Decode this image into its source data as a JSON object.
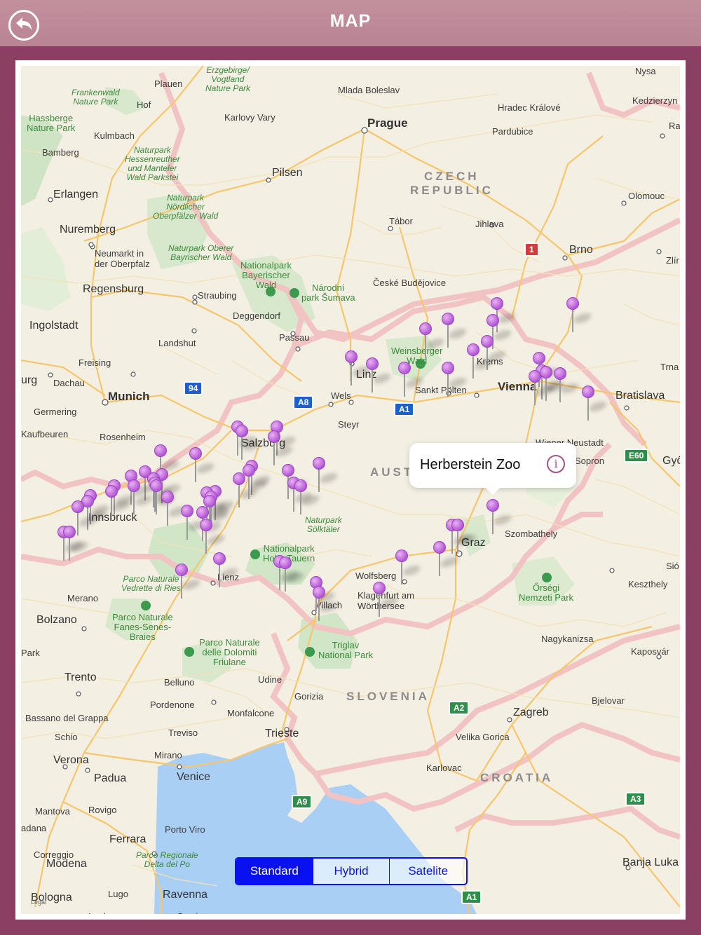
{
  "header": {
    "title": "MAP",
    "back_icon": "back-arrow-icon"
  },
  "colors": {
    "header": "#be8c9b",
    "frame": "#8b3f63",
    "accent": "#0a11f0",
    "pin": "#b455d6"
  },
  "callout": {
    "title": "Herberstein Zoo",
    "icon": "info-icon",
    "info_glyph": "i"
  },
  "map_type": {
    "options": [
      "Standard",
      "Hybrid",
      "Satelite"
    ],
    "selected": "Standard"
  },
  "legal": "Legal",
  "labels": {
    "plauen": "Plauen",
    "vogtland": "Erzgebirge/\nVogtland\nNature Park",
    "frankenwald": "Frankenwald\nNature Park",
    "hof": "Hof",
    "mlada": "Mlada Boleslav",
    "nysa": "Nysa",
    "kedz": "Kedzierzyn",
    "hradec": "Hradec Králové",
    "karlovy": "Karlovy Vary",
    "prague": "Prague",
    "hassberge": "Hassberge\nNature Park",
    "kulmbach": "Kulmbach",
    "pardubice": "Pardubice",
    "ra": "Ra",
    "bamberg": "Bamberg",
    "hessenreuther": "Naturpark\nHessenreuther\nund Manteler\nWald Parkstei",
    "pilsen": "Pilsen",
    "czech": "CZECH",
    "republic": "REPUBLIC",
    "erlangen": "Erlangen",
    "nordlicher": "Naturpark\nNördlicher\nOberpfälzer Wald",
    "olomouc": "Olomouc",
    "tabor": "Tábor",
    "jihlava": "Jihlava",
    "nuremberg": "Nuremberg",
    "neumarkt": "Neumarkt in\nder Oberpfalz",
    "bayrischer": "Naturpark Oberer\nBayrischer Wald",
    "brno": "Brno",
    "zlin": "Zlír",
    "np_bayerischer": "Nationalpark\nBayerischer\nWald",
    "sumava": "Národní\npark Šumava",
    "budejovice": "České Budějovice",
    "regensburg": "Regensburg",
    "straubing": "Straubing",
    "deggendorf": "Deggendorf",
    "ingolstadt": "Ingolstadt",
    "passau": "Passau",
    "landshut": "Landshut",
    "weinsberger": "Weinsberger\nWald",
    "krems": "Krems",
    "trna": "Trna",
    "freising": "Freising",
    "linz": "Linz",
    "urg": "urg",
    "dachau": "Dachau",
    "sankt": "Sankt Pölten",
    "vienna": "Vienna",
    "bratislava": "Bratislava",
    "munich": "Munich",
    "wels": "Wels",
    "germering": "Germering",
    "steyr": "Steyr",
    "kaufbeuren": "Kaufbeuren",
    "rosenheim": "Rosenheim",
    "salzburg": "Salzburg",
    "wiener": "Wiener Neustadt",
    "sopron": "Sopron",
    "gyo": "Győ",
    "austria": "AUSTRIA",
    "innsbruck": "Innsbruck",
    "solktaler": "Naturpark\nSölktäler",
    "graz": "Graz",
    "szombathely": "Szombathely",
    "hohe": "Nationalpark\nHohe Tauern",
    "sio": "Sió",
    "rieser": "Parco Naturale\nVedrette di Ries",
    "lienz": "Lienz",
    "wolfsberg": "Wolfsberg",
    "keszthely": "Keszthely",
    "orsegi": "Őrségi\nNemzeti Park",
    "merano": "Merano",
    "klagenfurt": "Klagenfurt am\nWörthersee",
    "villach": "Villach",
    "bolzano": "Bolzano",
    "fanes": "Parco Naturale\nFanes-Senes-\nBraies",
    "nagykanizsa": "Nagykanizsa",
    "dolomiti": "Parco Naturale\ndelle Dolomiti\nFriulane",
    "triglav": "Triglav\nNational Park",
    "park": "Park",
    "kaposvar": "Kaposvár",
    "trento": "Trento",
    "belluno": "Belluno",
    "udine": "Udine",
    "slovenia": "SLOVENIA",
    "gorizia": "Gorizia",
    "bjelovar": "Bjelovar",
    "pordenone": "Pordenone",
    "zagreb": "Zagreb",
    "bassano": "Bassano del Grappa",
    "monfalcone": "Monfalcone",
    "trieste": "Trieste",
    "schio": "Schio",
    "treviso": "Treviso",
    "velika": "Velika Gorica",
    "verona": "Verona",
    "mirano": "Mirano",
    "padua": "Padua",
    "venice": "Venice",
    "karlovac": "Karlovac",
    "croatia": "CROATIA",
    "mantova": "Mantova",
    "rovigo": "Rovigo",
    "adana": "adana",
    "porto": "Porto Viro",
    "ferrara": "Ferrara",
    "delta": "Parco Regionale\nDelta del Po",
    "correggio": "Correggio",
    "modena": "Modena",
    "banja": "Banja Luka",
    "bologna": "Bologna",
    "lugo": "Lugo",
    "ravenna": "Ravenna",
    "imola": "Imola",
    "cervia": "Cervia"
  },
  "shields": {
    "a94": "94",
    "a8": "A8",
    "a1": "A1",
    "e60": "E60",
    "r1": "1",
    "a2": "A2",
    "a9": "A9",
    "a3": "A3",
    "a1b": "A1"
  }
}
